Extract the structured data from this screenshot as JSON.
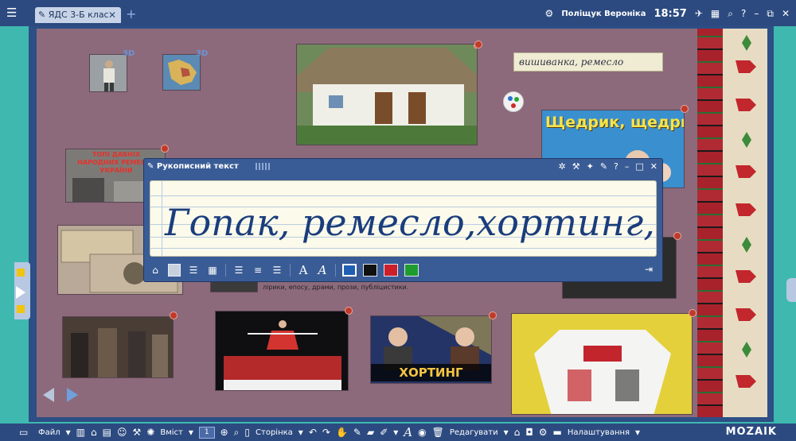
{
  "topbar": {
    "tab_title": "ЯДС 3-Б клас",
    "user_name": "Поліщук Вероніка",
    "time": "18:57"
  },
  "board": {
    "thumb_3d_1_label": "3D",
    "thumb_3d_2_label": "3D",
    "tag_label": "вишиванка, ремесло",
    "shchedryk_title": "Щедрик, щедрик",
    "traditions_title": "ТОПІ ДАВНІХ НАРОДНИХ РЕМЕСЕЛ УКРАЇНИ",
    "literature_caption": "лірики, епосу, драми, прози, публіцистики.",
    "hortyng_label": "ХОРТИНГ"
  },
  "handwriting": {
    "title": "Рукописний текст",
    "text": "Гопак, ремесло,хортинг, "
  },
  "bottombar": {
    "file_label": "Файл",
    "content_label": "Вміст",
    "page_number": "1",
    "page_label": "Сторінка",
    "edit_label": "Редагувати",
    "settings_label": "Налаштування",
    "logo": "MOZAIK"
  },
  "colors": {
    "blue": "#1f5fb4",
    "black": "#111111",
    "red": "#cc1f2a",
    "green": "#1f9c2e"
  }
}
